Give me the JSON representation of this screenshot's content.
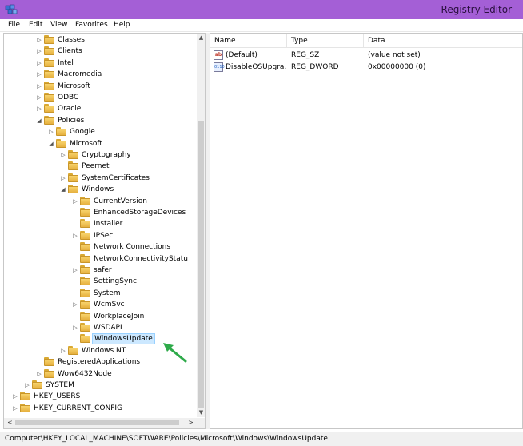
{
  "window": {
    "title": "Registry Editor"
  },
  "menubar": {
    "items": [
      "File",
      "Edit",
      "View",
      "Favorites",
      "Help"
    ]
  },
  "tree": {
    "nodes": [
      {
        "label": "Classes",
        "level": 3,
        "expander": "collapsed"
      },
      {
        "label": "Clients",
        "level": 3,
        "expander": "collapsed"
      },
      {
        "label": "Intel",
        "level": 3,
        "expander": "collapsed"
      },
      {
        "label": "Macromedia",
        "level": 3,
        "expander": "collapsed"
      },
      {
        "label": "Microsoft",
        "level": 3,
        "expander": "collapsed"
      },
      {
        "label": "ODBC",
        "level": 3,
        "expander": "collapsed"
      },
      {
        "label": "Oracle",
        "level": 3,
        "expander": "collapsed"
      },
      {
        "label": "Policies",
        "level": 3,
        "expander": "expanded"
      },
      {
        "label": "Google",
        "level": 4,
        "expander": "collapsed"
      },
      {
        "label": "Microsoft",
        "level": 4,
        "expander": "expanded"
      },
      {
        "label": "Cryptography",
        "level": 5,
        "expander": "collapsed"
      },
      {
        "label": "Peernet",
        "level": 5,
        "expander": "none"
      },
      {
        "label": "SystemCertificates",
        "level": 5,
        "expander": "collapsed"
      },
      {
        "label": "Windows",
        "level": 5,
        "expander": "expanded"
      },
      {
        "label": "CurrentVersion",
        "level": 6,
        "expander": "collapsed"
      },
      {
        "label": "EnhancedStorageDevices",
        "level": 6,
        "expander": "none"
      },
      {
        "label": "Installer",
        "level": 6,
        "expander": "none"
      },
      {
        "label": "IPSec",
        "level": 6,
        "expander": "collapsed"
      },
      {
        "label": "Network Connections",
        "level": 6,
        "expander": "none"
      },
      {
        "label": "NetworkConnectivityStatu",
        "level": 6,
        "expander": "none"
      },
      {
        "label": "safer",
        "level": 6,
        "expander": "collapsed"
      },
      {
        "label": "SettingSync",
        "level": 6,
        "expander": "none"
      },
      {
        "label": "System",
        "level": 6,
        "expander": "none"
      },
      {
        "label": "WcmSvc",
        "level": 6,
        "expander": "collapsed"
      },
      {
        "label": "WorkplaceJoin",
        "level": 6,
        "expander": "none"
      },
      {
        "label": "WSDAPI",
        "level": 6,
        "expander": "collapsed"
      },
      {
        "label": "WindowsUpdate",
        "level": 6,
        "expander": "none",
        "selected": true
      },
      {
        "label": "Windows NT",
        "level": 5,
        "expander": "collapsed"
      },
      {
        "label": "RegisteredApplications",
        "level": 3,
        "expander": "none"
      },
      {
        "label": "Wow6432Node",
        "level": 3,
        "expander": "collapsed"
      },
      {
        "label": "SYSTEM",
        "level": 2,
        "expander": "collapsed"
      },
      {
        "label": "HKEY_USERS",
        "level": 1,
        "expander": "collapsed"
      },
      {
        "label": "HKEY_CURRENT_CONFIG",
        "level": 1,
        "expander": "collapsed"
      }
    ]
  },
  "list": {
    "columns": [
      "Name",
      "Type",
      "Data"
    ],
    "rows": [
      {
        "name": "(Default)",
        "type": "REG_SZ",
        "data": "(value not set)",
        "icon": "string-value-icon"
      },
      {
        "name": "DisableOSUpgra...",
        "type": "REG_DWORD",
        "data": "0x00000000 (0)",
        "icon": "dword-value-icon"
      }
    ]
  },
  "statusbar": {
    "path": "Computer\\HKEY_LOCAL_MACHINE\\SOFTWARE\\Policies\\Microsoft\\Windows\\WindowsUpdate"
  },
  "icons": {
    "string": "ab",
    "dword": "011\n110"
  },
  "colors": {
    "titlebar": "#a45fd6",
    "selection": "#cce8ff",
    "annotation_arrow": "#2eaa4a"
  }
}
